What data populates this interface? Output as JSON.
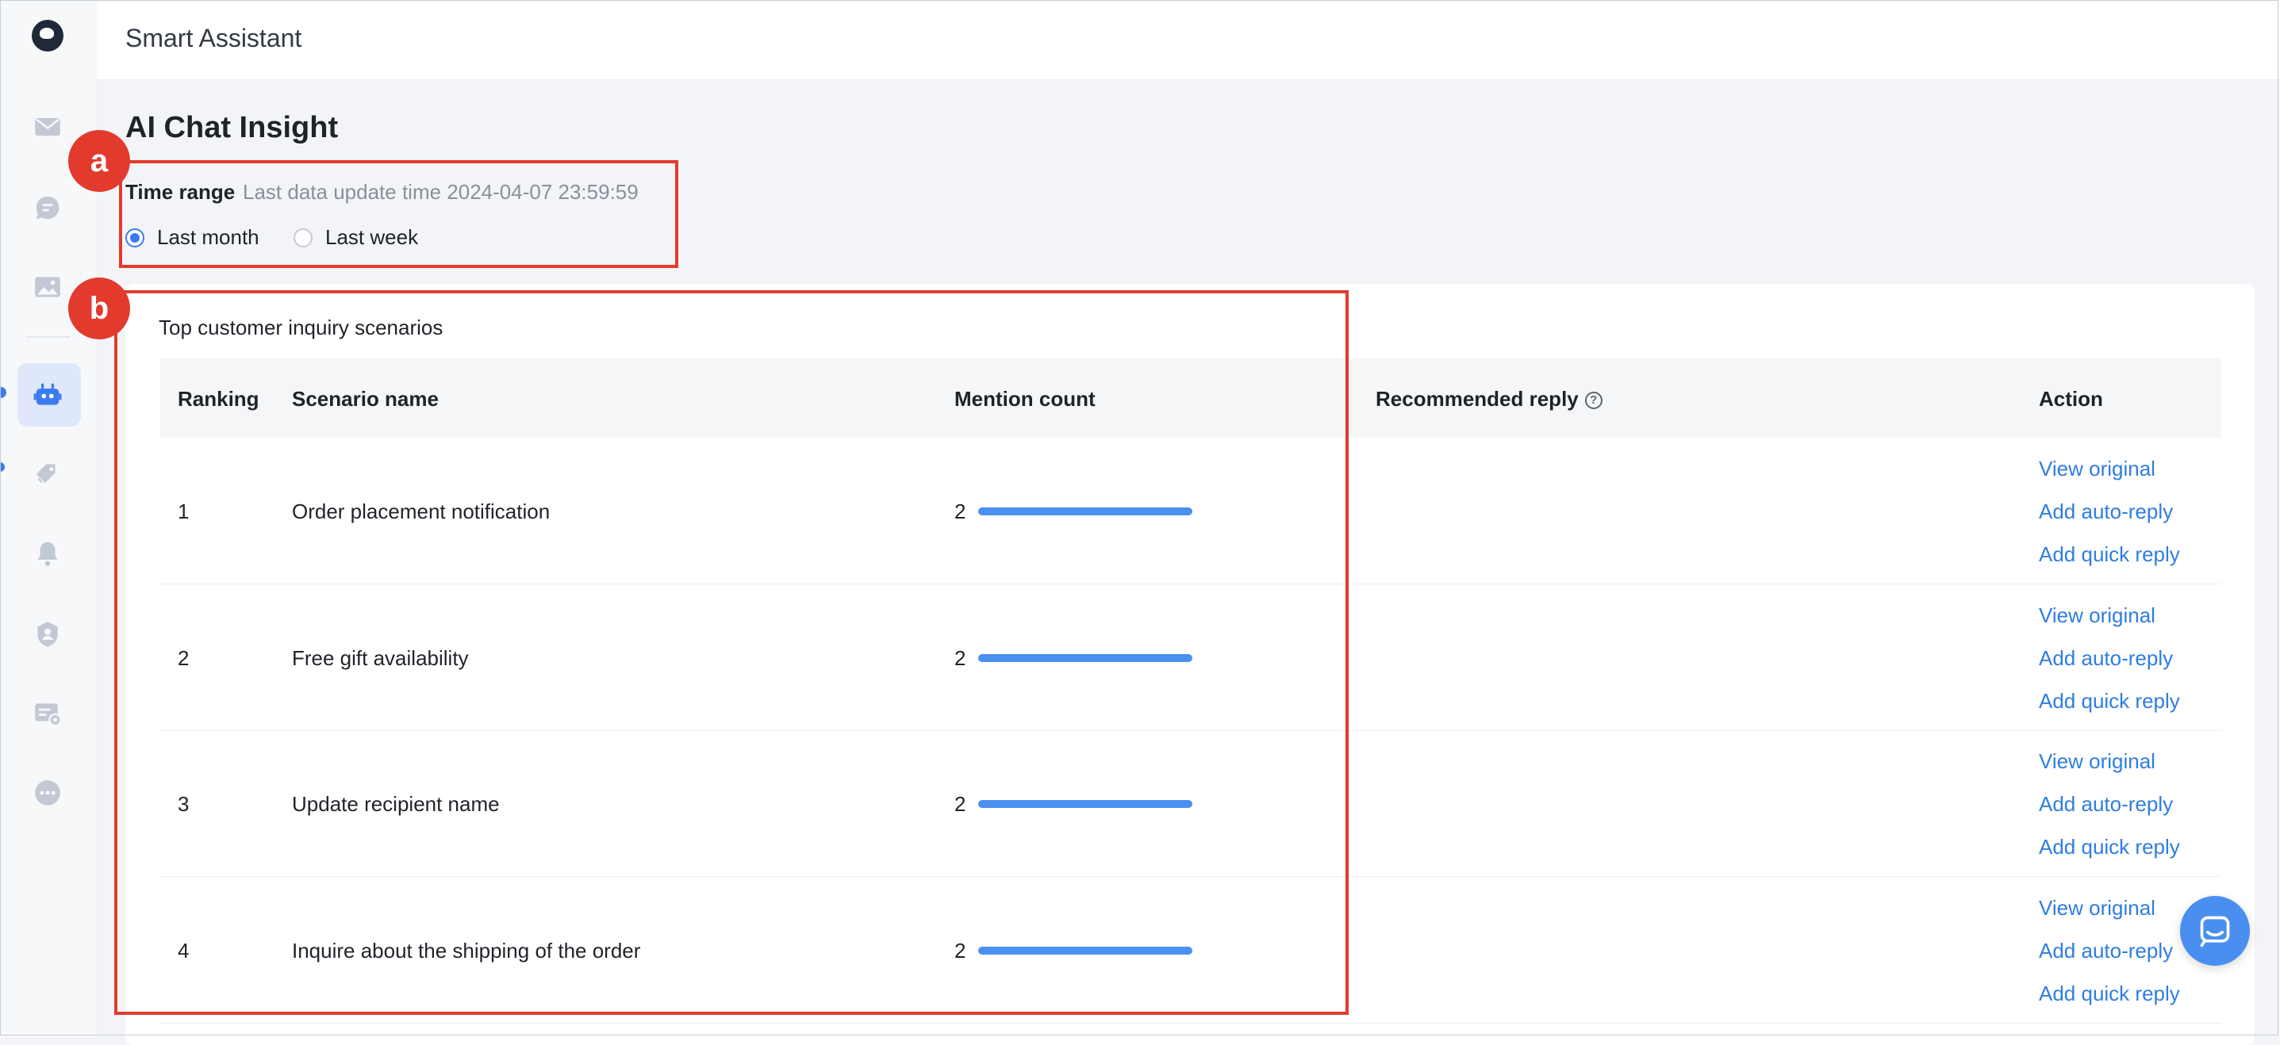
{
  "header": {
    "app_title": "Smart Assistant"
  },
  "page": {
    "title": "AI Chat Insight",
    "time_range": {
      "label": "Time range",
      "last_update": "Last data update time 2024-04-07 23:59:59",
      "options": [
        {
          "label": "Last month",
          "checked": true
        },
        {
          "label": "Last week",
          "checked": false
        }
      ]
    }
  },
  "card": {
    "title": "Top customer inquiry scenarios",
    "columns": [
      "Ranking",
      "Scenario name",
      "Mention count",
      "Recommended reply",
      "Action"
    ],
    "rows": [
      {
        "ranking": "1",
        "scenario": "Order placement notification",
        "count": "2",
        "bar_fraction": 1.0
      },
      {
        "ranking": "2",
        "scenario": "Free gift availability",
        "count": "2",
        "bar_fraction": 1.0
      },
      {
        "ranking": "3",
        "scenario": "Update recipient name",
        "count": "2",
        "bar_fraction": 1.0
      },
      {
        "ranking": "4",
        "scenario": "Inquire about the shipping of the order",
        "count": "2",
        "bar_fraction": 1.0
      }
    ],
    "actions": [
      "View original",
      "Add auto-reply",
      "Add quick reply"
    ]
  },
  "annotations": {
    "a": "a",
    "b": "b"
  },
  "sidebar": {
    "icons": [
      "mail-icon",
      "chat-icon",
      "image-icon",
      "robot-icon",
      "tag-icon",
      "bell-icon",
      "user-shield-icon",
      "card-settings-icon",
      "more-icon"
    ]
  },
  "colors": {
    "accent": "#3b7bf0",
    "link": "#2f7de1",
    "bar": "#4a90f0",
    "annotation": "#e23b2e"
  }
}
